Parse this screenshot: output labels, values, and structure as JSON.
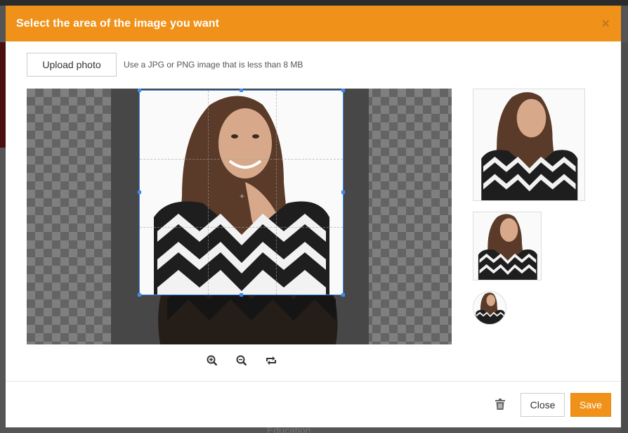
{
  "background_page": {
    "footer_fragment": "Education"
  },
  "modal": {
    "title": "Select the area of the image you want",
    "close_glyph": "×",
    "upload_label": "Upload photo",
    "upload_hint": "Use a JPG or PNG image that is less than 8 MB",
    "crop_center_glyph": "+",
    "tools": {
      "zoom_in_icon": "zoom-in-icon",
      "zoom_out_icon": "zoom-out-icon",
      "rotate_icon": "rotate-icon"
    },
    "footer": {
      "delete_icon": "trash-icon",
      "close_label": "Close",
      "save_label": "Save"
    }
  },
  "colors": {
    "accent": "#f0921a",
    "crop_border": "#3d8cf0"
  }
}
